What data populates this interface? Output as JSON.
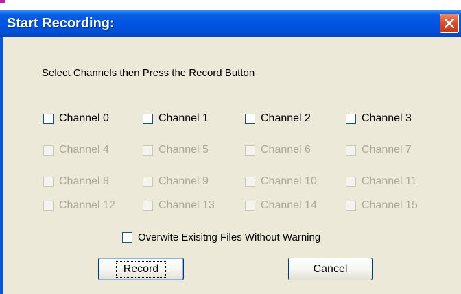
{
  "window": {
    "title": "Start Recording:",
    "close_label": "close"
  },
  "instructions": "Select Channels then Press the Record Button",
  "channels": [
    {
      "label": "Channel 0",
      "enabled": true,
      "checked": false
    },
    {
      "label": "Channel 1",
      "enabled": true,
      "checked": false
    },
    {
      "label": "Channel 2",
      "enabled": true,
      "checked": false
    },
    {
      "label": "Channel 3",
      "enabled": true,
      "checked": false
    },
    {
      "label": "Channel 4",
      "enabled": false,
      "checked": false
    },
    {
      "label": "Channel 5",
      "enabled": false,
      "checked": false
    },
    {
      "label": "Channel 6",
      "enabled": false,
      "checked": false
    },
    {
      "label": "Channel 7",
      "enabled": false,
      "checked": false
    },
    {
      "label": "Channel 8",
      "enabled": false,
      "checked": false
    },
    {
      "label": "Channel 9",
      "enabled": false,
      "checked": false
    },
    {
      "label": "Channel 10",
      "enabled": false,
      "checked": false
    },
    {
      "label": "Channel 11",
      "enabled": false,
      "checked": false
    },
    {
      "label": "Channel 12",
      "enabled": false,
      "checked": false
    },
    {
      "label": "Channel 13",
      "enabled": false,
      "checked": false
    },
    {
      "label": "Channel 14",
      "enabled": false,
      "checked": false
    },
    {
      "label": "Channel 15",
      "enabled": false,
      "checked": false
    }
  ],
  "overwrite": {
    "label": "Overwite Exisitng Files Without Warning",
    "checked": false
  },
  "buttons": {
    "record": "Record",
    "cancel": "Cancel"
  },
  "colors": {
    "titlebar": "#0054e3",
    "dialog_bg": "#ece9d8",
    "close": "#d8502f",
    "disabled_text": "#aca899"
  }
}
